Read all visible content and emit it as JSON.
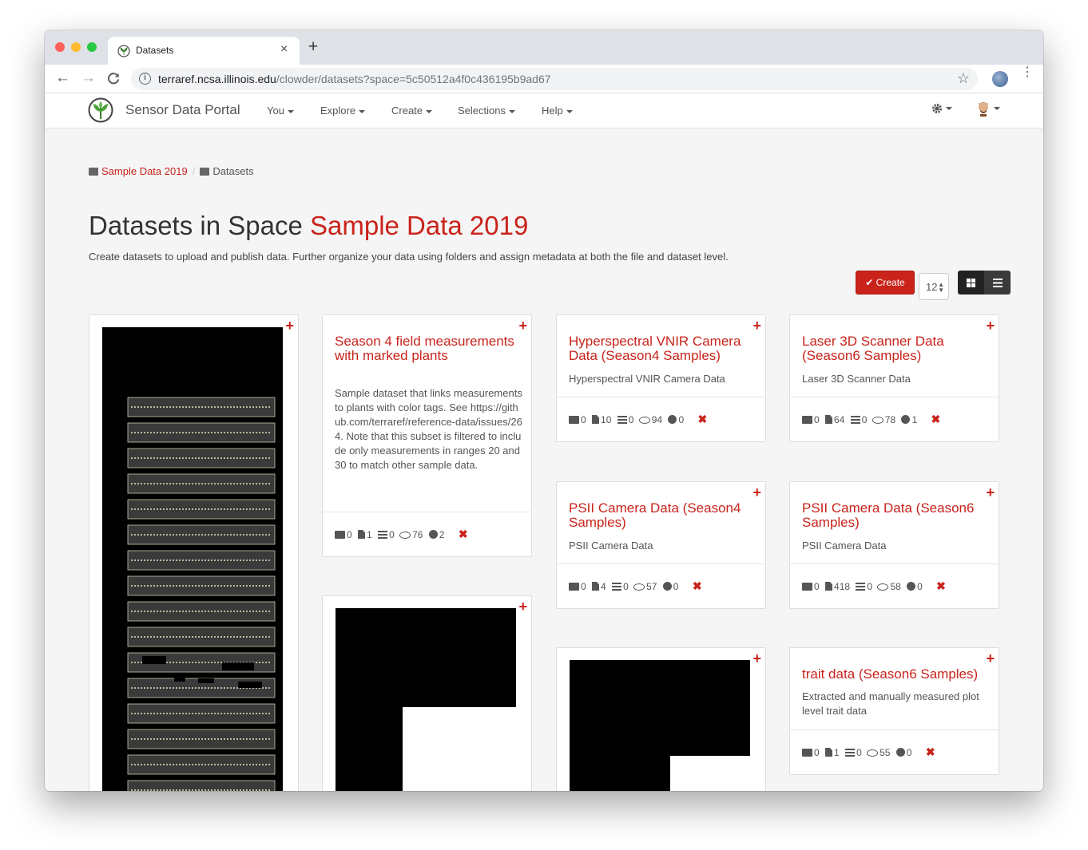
{
  "browser": {
    "tab_title": "Datasets",
    "tab_close": "×",
    "new_tab": "+",
    "url_host": "terraref.ncsa.illinois.edu",
    "url_path": "/clowder/datasets?space=5c50512a4f0c436195b9ad67",
    "back": "←",
    "forward": "→",
    "reload": "C",
    "star": "☆",
    "menu": "⋮",
    "lights": {
      "close": "#fe5f57",
      "minimize": "#febc2e",
      "maximize": "#28c840"
    }
  },
  "navbar": {
    "brand": "Sensor Data Portal",
    "menus": [
      "You",
      "Explore",
      "Create",
      "Selections",
      "Help"
    ],
    "settings_icon": "gear-icon",
    "user_icon": "avatar"
  },
  "breadcrumb": {
    "space": "Sample Data 2019",
    "separator": "/",
    "current": "Datasets"
  },
  "header": {
    "title_prefix": "Datasets in Space ",
    "title_space": "Sample Data 2019",
    "lede": "Create datasets to upload and publish data. Further organize your data using folders and assign metadata at both the file and dataset level."
  },
  "controls": {
    "create_label": "✔ Create",
    "page_size": "12",
    "view_modes": [
      "grid",
      "list"
    ]
  },
  "colors": {
    "accent": "#c9231b",
    "text": "#333333",
    "muted": "#555555"
  },
  "cards": [
    {
      "title": "Season 4 field measurements with marked plants",
      "description": "Sample dataset that links measurements to plants with color tags. See https://github.com/terraref/reference-data/issues/264. Note that this subset is filtered to include only measurements in ranges 20 and 30 to match other sample data.",
      "folders": "0",
      "files": "1",
      "metadata": "0",
      "views": "76",
      "downloads": "2"
    },
    {
      "title": "Hyperspectral VNIR Camera Data (Season4 Samples)",
      "description": "Hyperspectral VNIR Camera Data",
      "folders": "0",
      "files": "10",
      "metadata": "0",
      "views": "94",
      "downloads": "0"
    },
    {
      "title": "Laser 3D Scanner Data (Season6 Samples)",
      "description": "Laser 3D Scanner Data",
      "folders": "0",
      "files": "64",
      "metadata": "0",
      "views": "78",
      "downloads": "1"
    },
    {
      "title": "PSII Camera Data (Season4 Samples)",
      "description": "PSII Camera Data",
      "folders": "0",
      "files": "4",
      "metadata": "0",
      "views": "57",
      "downloads": "0"
    },
    {
      "title": "PSII Camera Data (Season6 Samples)",
      "description": "PSII Camera Data",
      "folders": "0",
      "files": "418",
      "metadata": "0",
      "views": "58",
      "downloads": "0"
    },
    {
      "title": "trait data (Season6 Samples)",
      "description": "Extracted and manually measured plot level trait data",
      "folders": "0",
      "files": "1",
      "metadata": "0",
      "views": "55",
      "downloads": "0"
    }
  ],
  "icons": {
    "add": "+",
    "delete": "✖"
  }
}
